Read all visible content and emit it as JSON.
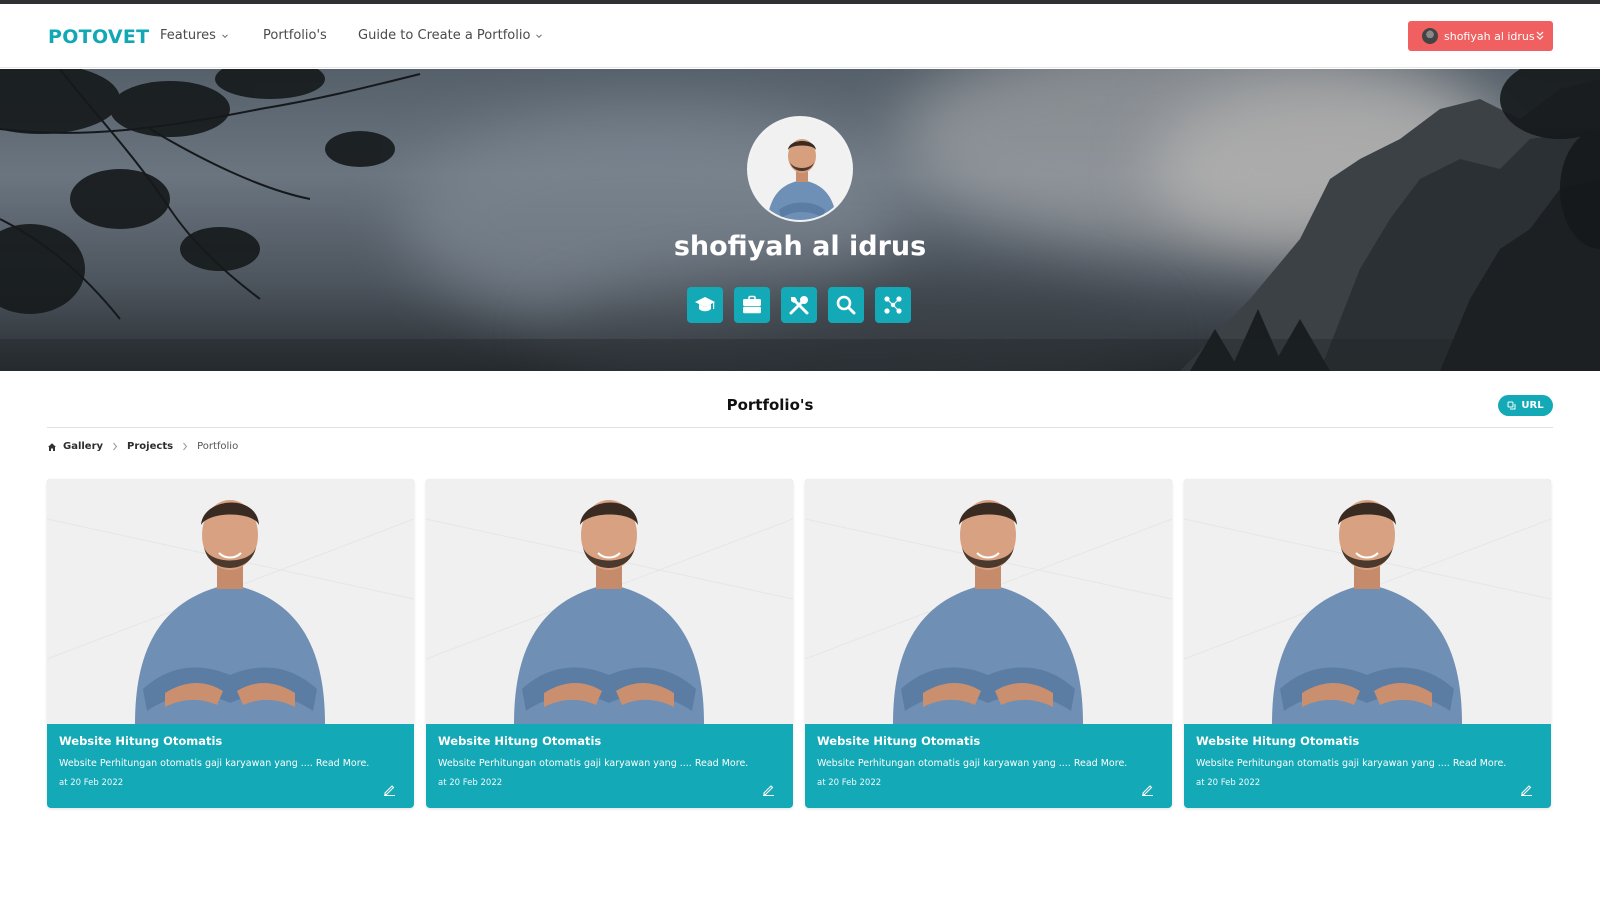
{
  "navbar": {
    "brand": "POTOVET",
    "items": [
      {
        "label": "Features",
        "icon": "chevron-down-icon"
      },
      {
        "label": "Portfolio's"
      },
      {
        "label": "Guide to Create a Portfolio",
        "icon": "chevron-down-icon"
      }
    ],
    "user_button": {
      "label": "shofiyah al idrus",
      "icon": "double-chevron-down-icon",
      "color": "#f06060"
    }
  },
  "hero": {
    "name": "shofiyah al idrus",
    "icons": [
      "graduation-cap-icon",
      "briefcase-icon",
      "tools-icon",
      "search-icon",
      "network-icon"
    ],
    "accent": "#13a9b6"
  },
  "section": {
    "title": "Portfolio's",
    "url_button": "URL"
  },
  "breadcrumb": [
    {
      "label": "Gallery",
      "icon": "home-icon"
    },
    {
      "label": "Projects"
    },
    {
      "label": "Portfolio"
    }
  ],
  "cards": [
    {
      "title": "Website Hitung Otomatis",
      "description": "Website Perhitungan otomatis gaji karyawan yang .... Read More.",
      "date": "at 20 Feb 2022"
    },
    {
      "title": "Website Hitung Otomatis",
      "description": "Website Perhitungan otomatis gaji karyawan yang .... Read More.",
      "date": "at 20 Feb 2022"
    },
    {
      "title": "Website Hitung Otomatis",
      "description": "Website Perhitungan otomatis gaji karyawan yang .... Read More.",
      "date": "at 20 Feb 2022"
    },
    {
      "title": "Website Hitung Otomatis",
      "description": "Website Perhitungan otomatis gaji karyawan yang .... Read More.",
      "date": "at 20 Feb 2022"
    }
  ]
}
